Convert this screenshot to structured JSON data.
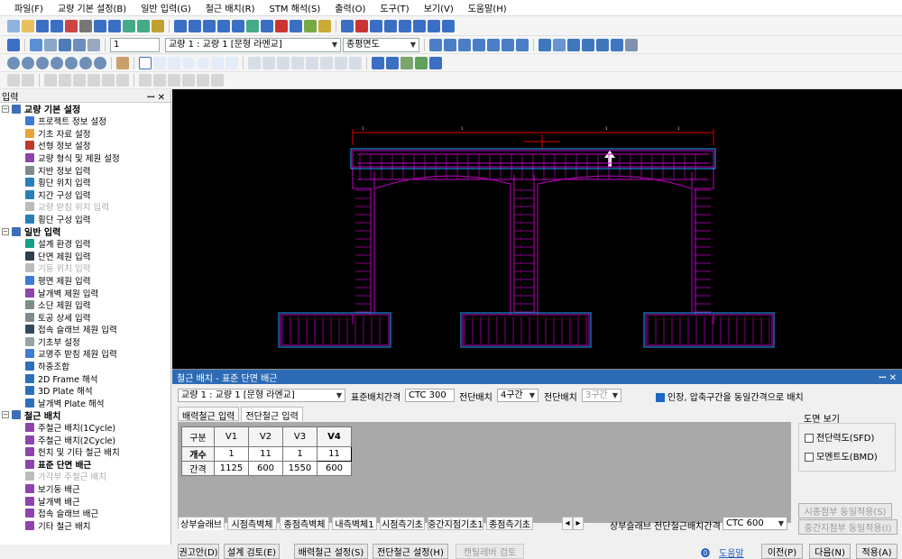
{
  "menubar": [
    "파일(F)",
    "교량 기본 설정(B)",
    "일반 입력(G)",
    "철근 배치(R)",
    "STM 해석(S)",
    "출력(O)",
    "도구(T)",
    "보기(V)",
    "도움말(H)"
  ],
  "toolbar2": {
    "index_value": "1",
    "bridge_select": "교량 1 : 교량 1 [문형 라멘교]",
    "view_select": "종평면도"
  },
  "left_panel": {
    "title": "입력",
    "groups": [
      {
        "label": "교량 기본 설정",
        "items": [
          {
            "label": "프로젝트 정보 설정",
            "icon_color": "#3d7bd6"
          },
          {
            "label": "기초 자료 설정",
            "icon_color": "#e8a33a"
          },
          {
            "label": "선형 정보 설정",
            "icon_color": "#c0392b"
          },
          {
            "label": "교량 형식 및 제원 설정",
            "icon_color": "#8e44ad"
          },
          {
            "label": "지반 정보 입력",
            "icon_color": "#7f8c8d"
          },
          {
            "label": "횡단 위치 입력",
            "icon_color": "#2980b9"
          },
          {
            "label": "지간 구성 입력",
            "icon_color": "#2980b9"
          },
          {
            "label": "교량 받침 위치 입력",
            "icon_color": "#bbbbbb",
            "disabled": true
          },
          {
            "label": "횡단 구성 입력",
            "icon_color": "#2980b9"
          }
        ]
      },
      {
        "label": "일반 입력",
        "items": [
          {
            "label": "설계 환경 입력",
            "icon_color": "#16a085"
          },
          {
            "label": "단면 제원 입력",
            "icon_color": "#2c3e50"
          },
          {
            "label": "기둥 위치 입력",
            "icon_color": "#bbbbbb",
            "disabled": true
          },
          {
            "label": "평면 제원 입력",
            "icon_color": "#3d7bd6"
          },
          {
            "label": "날개벽 제원 입력",
            "icon_color": "#8e44ad"
          },
          {
            "label": "소단 제원 입력",
            "icon_color": "#7f8c8d"
          },
          {
            "label": "토공 상세 입력",
            "icon_color": "#7f8c8d"
          },
          {
            "label": "접속 슬래브 제원 입력",
            "icon_color": "#34495e"
          },
          {
            "label": "기초부 설정",
            "icon_color": "#95a5a6"
          },
          {
            "label": "교명주 받침 제원 입력",
            "icon_color": "#3d7bd6"
          },
          {
            "label": "하중조합",
            "icon_color": "#2c6fbb"
          },
          {
            "label": "2D Frame 해석",
            "icon_color": "#2c6fbb"
          },
          {
            "label": "3D Plate 해석",
            "icon_color": "#2c6fbb"
          },
          {
            "label": "날개벽 Plate 해석",
            "icon_color": "#2c6fbb"
          }
        ]
      },
      {
        "label": "철근 배치",
        "items": [
          {
            "label": "주철근 배치(1Cycle)",
            "icon_color": "#8e44ad"
          },
          {
            "label": "주철근 배치(2Cycle)",
            "icon_color": "#8e44ad"
          },
          {
            "label": "헌치 및 기타 철근 배치",
            "icon_color": "#8e44ad"
          },
          {
            "label": "표준 단면 배근",
            "icon_color": "#8e44ad",
            "bold": true
          },
          {
            "label": "가각부 주철근 배치",
            "icon_color": "#bbbbbb",
            "disabled": true
          },
          {
            "label": "보기둥 배근",
            "icon_color": "#8e44ad"
          },
          {
            "label": "날개벽 배근",
            "icon_color": "#8e44ad"
          },
          {
            "label": "접속 슬래브 배근",
            "icon_color": "#8e44ad"
          },
          {
            "label": "기타 철근 배치",
            "icon_color": "#8e44ad"
          }
        ]
      }
    ]
  },
  "dialog": {
    "title": "철근 배치 - 표준 단면 배근",
    "bridge_select": "교량 1 : 교량 1 [문형 라멘교]",
    "std_spacing_label": "표준배치간격",
    "std_spacing_value": "CTC 300",
    "shear_arrangement_label": "전단배치",
    "shear_arrangement_value": "4구간",
    "shear_bar_label": "전단배치",
    "shear_bar_value": "3구간",
    "checkbox_label": "인장, 압축구간을 동일간격으로 배치",
    "tabs": [
      "배력철근 입력",
      "전단철근 입력"
    ],
    "drawing_view": {
      "title": "도면 보기",
      "options": [
        "전단력도(SFD)",
        "모멘트도(BMD)"
      ]
    },
    "table": {
      "headers": [
        "구분",
        "V1",
        "V2",
        "V3",
        "V4"
      ],
      "rows": [
        {
          "label": "개수",
          "values": [
            "1",
            "11",
            "1",
            "11"
          ]
        },
        {
          "label": "간격",
          "values": [
            "1125",
            "600",
            "1550",
            "600"
          ]
        }
      ]
    },
    "subtabs": [
      "상부슬래브",
      "시점측벽체",
      "종점측벽체",
      "내측벽체1",
      "시점측기초",
      "중간지점기초1",
      "종점측기초"
    ],
    "slab_shear_label": "상부슬래브 전단철근배치간격",
    "slab_shear_value": "CTC 600",
    "apply_start": "시종점부 동일적용(S)",
    "apply_mid": "중간지점부 동일적용(I)",
    "buttons": {
      "recommend": "권고안(D)",
      "check": "설계 검토(E)",
      "dist_rebar": "배력철근 설정(S)",
      "shear_rebar": "전단철근 설정(H)",
      "cantilever": "캔틸레버 검토",
      "help": "도움말",
      "prev": "이전(P)",
      "next": "다음(N)",
      "apply": "적용(A)"
    }
  }
}
